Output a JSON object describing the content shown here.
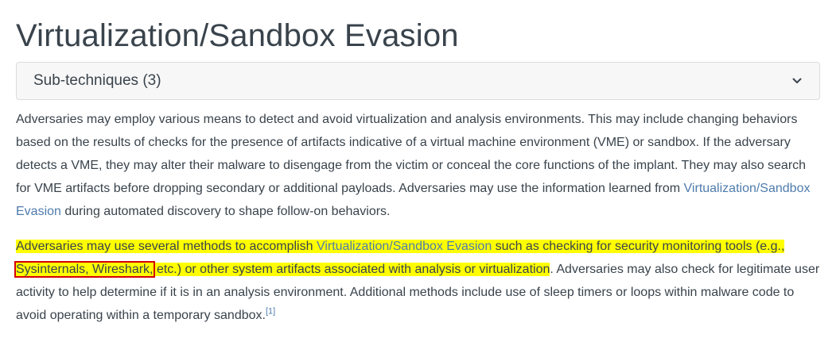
{
  "page": {
    "title": "Virtualization/Sandbox Evasion"
  },
  "subtechniques": {
    "label": "Sub-techniques (3)",
    "icon": "chevron-down-icon"
  },
  "paragraph1": {
    "text_a": "Adversaries may employ various means to detect and avoid virtualization and analysis environments. This may include changing behaviors based on the results of checks for the presence of artifacts indicative of a virtual machine environment (VME) or sandbox. If the adversary detects a VME, they may alter their malware to disengage from the victim or conceal the core functions of the implant. They may also search for VME artifacts before dropping secondary or additional payloads. Adversaries may use the information learned from ",
    "link": "Virtualization/Sandbox Evasion",
    "text_b": " during automated discovery to shape follow-on behaviors."
  },
  "paragraph2": {
    "text_a": "Adversaries may use several methods to accomplish ",
    "link": "Virtualization/Sandbox Evasion",
    "text_b": " such as checking for security monitoring tools (e.g., ",
    "boxed_text": "Sysinternals, Wireshark,",
    "text_c": " etc.) or other system artifacts associated with analysis or virtualization",
    "text_d": ". Adversaries may also check for legitimate user activity to help determine if it is in an analysis environment. Additional methods include use of sleep timers or loops within malware code to avoid operating within a temporary sandbox.",
    "citation": "[1]"
  },
  "colors": {
    "text": "#39434c",
    "link": "#4f7cac",
    "highlight": "#ffff00",
    "annotation_box": "#d40000",
    "accordion_bg": "#f7f7f7",
    "accordion_border": "#dcdcdc"
  }
}
